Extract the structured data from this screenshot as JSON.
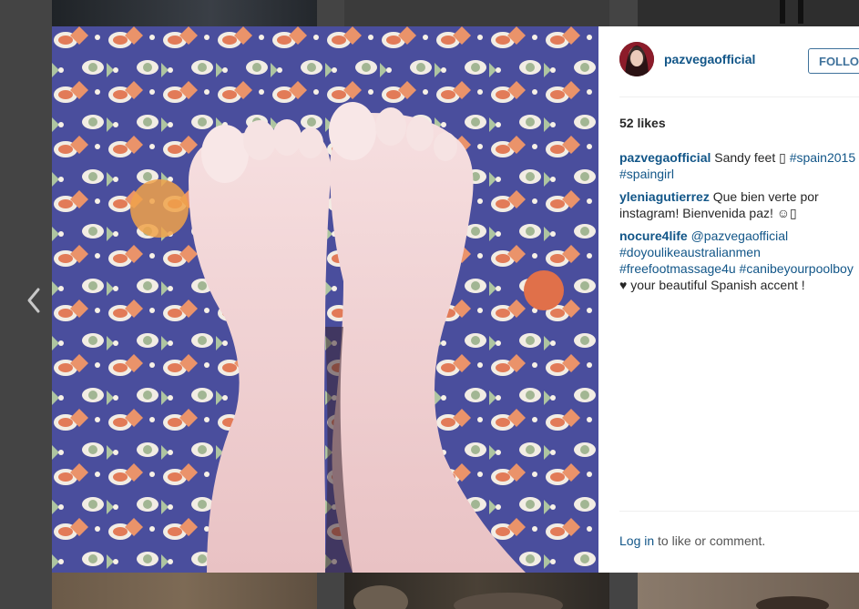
{
  "colors": {
    "link": "#125688",
    "follow": "#3f729b",
    "backdrop": "#444444"
  },
  "nav": {
    "prev_icon": "chevron-left-icon"
  },
  "post": {
    "author": "pazvegaofficial",
    "follow_label": "FOLLOW",
    "likes": "52 likes",
    "caption": {
      "user": "pazvegaofficial",
      "text": "Sandy feet ",
      "glyph": "▯",
      "tag1": "#spain2015",
      "tag2": "#spaingirl"
    },
    "comments": [
      {
        "user": "yleniagutierrez",
        "text1": "Que bien verte por",
        "text2": "instagram! Bienvenida paz! ☺▯"
      },
      {
        "user": "nocure4life",
        "mention": "@pazvegaofficial",
        "tag1": "#doyoulikeaustralianmen",
        "tag2": "#freefootmassage4u",
        "tag3": "#canibeyourpoolboy",
        "text": "♥ your beautiful Spanish accent !"
      }
    ],
    "footer": {
      "login": "Log in",
      "rest": " to like or comment."
    }
  }
}
